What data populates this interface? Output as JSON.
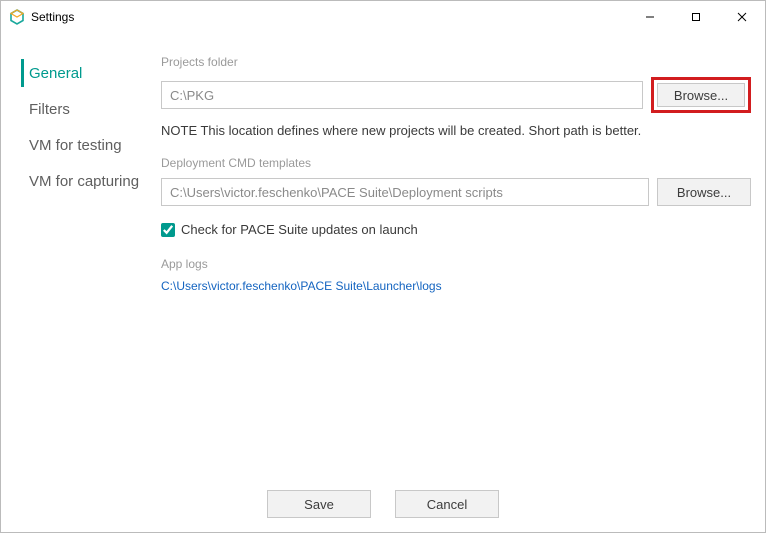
{
  "window": {
    "title": "Settings"
  },
  "sidebar": {
    "items": [
      {
        "label": "General",
        "active": true
      },
      {
        "label": "Filters",
        "active": false
      },
      {
        "label": "VM for testing",
        "active": false
      },
      {
        "label": "VM for capturing",
        "active": false
      }
    ]
  },
  "main": {
    "projects_label": "Projects folder",
    "projects_value": "C:\\PKG",
    "browse1_label": "Browse...",
    "note": "NOTE This location defines where new projects will be created. Short path is better.",
    "deploy_label": "Deployment CMD templates",
    "deploy_value": "C:\\Users\\victor.feschenko\\PACE Suite\\Deployment scripts",
    "browse2_label": "Browse...",
    "check_label": "Check for PACE Suite updates on launch",
    "check_value": true,
    "applogs_label": "App logs",
    "applogs_link": "C:\\Users\\victor.feschenko\\PACE Suite\\Launcher\\logs"
  },
  "footer": {
    "save": "Save",
    "cancel": "Cancel"
  }
}
